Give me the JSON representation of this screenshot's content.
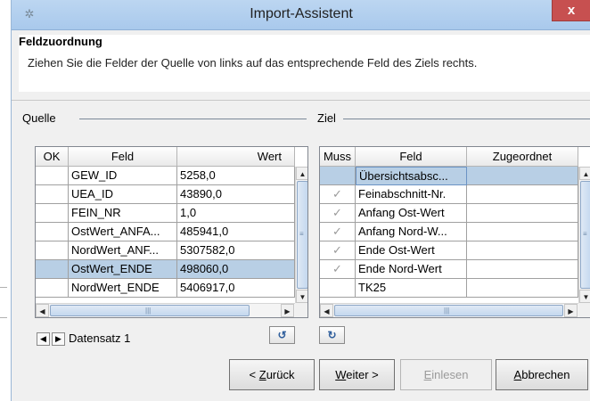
{
  "window": {
    "title": "Import-Assistent",
    "close_label": "x",
    "app_icon": "gear-icon"
  },
  "section": {
    "title": "Feldzuordnung",
    "description": "Ziehen Sie die Felder der Quelle von links auf das entsprechende Feld des Ziels rechts."
  },
  "quelle": {
    "label": "Quelle",
    "headers": [
      "OK",
      "Feld",
      "Wert"
    ],
    "rows": [
      {
        "ok": "",
        "feld": "GEW_ID",
        "wert": "5258,0"
      },
      {
        "ok": "",
        "feld": "UEA_ID",
        "wert": "43890,0"
      },
      {
        "ok": "",
        "feld": "FEIN_NR",
        "wert": "1,0"
      },
      {
        "ok": "",
        "feld": "OstWert_ANFA...",
        "wert": "485941,0"
      },
      {
        "ok": "",
        "feld": "NordWert_ANF...",
        "wert": "5307582,0"
      },
      {
        "ok": "",
        "feld": "OstWert_ENDE",
        "wert": "498060,0"
      },
      {
        "ok": "",
        "feld": "NordWert_ENDE",
        "wert": "5406917,0"
      }
    ],
    "selected_row": 5
  },
  "ziel": {
    "label": "Ziel",
    "headers": [
      "Muss",
      "Feld",
      "Zugeordnet"
    ],
    "rows": [
      {
        "muss": "",
        "feld": "Übersichtsabsc...",
        "zugeordnet": ""
      },
      {
        "muss": "✓",
        "feld": "Feinabschnitt-Nr.",
        "zugeordnet": ""
      },
      {
        "muss": "✓",
        "feld": "Anfang Ost-Wert",
        "zugeordnet": ""
      },
      {
        "muss": "✓",
        "feld": "Anfang Nord-W...",
        "zugeordnet": ""
      },
      {
        "muss": "✓",
        "feld": "Ende Ost-Wert",
        "zugeordnet": ""
      },
      {
        "muss": "✓",
        "feld": "Ende Nord-Wert",
        "zugeordnet": ""
      },
      {
        "muss": "",
        "feld": "TK25",
        "zugeordnet": ""
      }
    ],
    "selected_row": 0
  },
  "navigation": {
    "datensatz_label": "Datensatz 1"
  },
  "buttons": {
    "back": "< Zurück",
    "next": "Weiter >",
    "import": "Einlesen",
    "cancel": "Abbrechen"
  }
}
